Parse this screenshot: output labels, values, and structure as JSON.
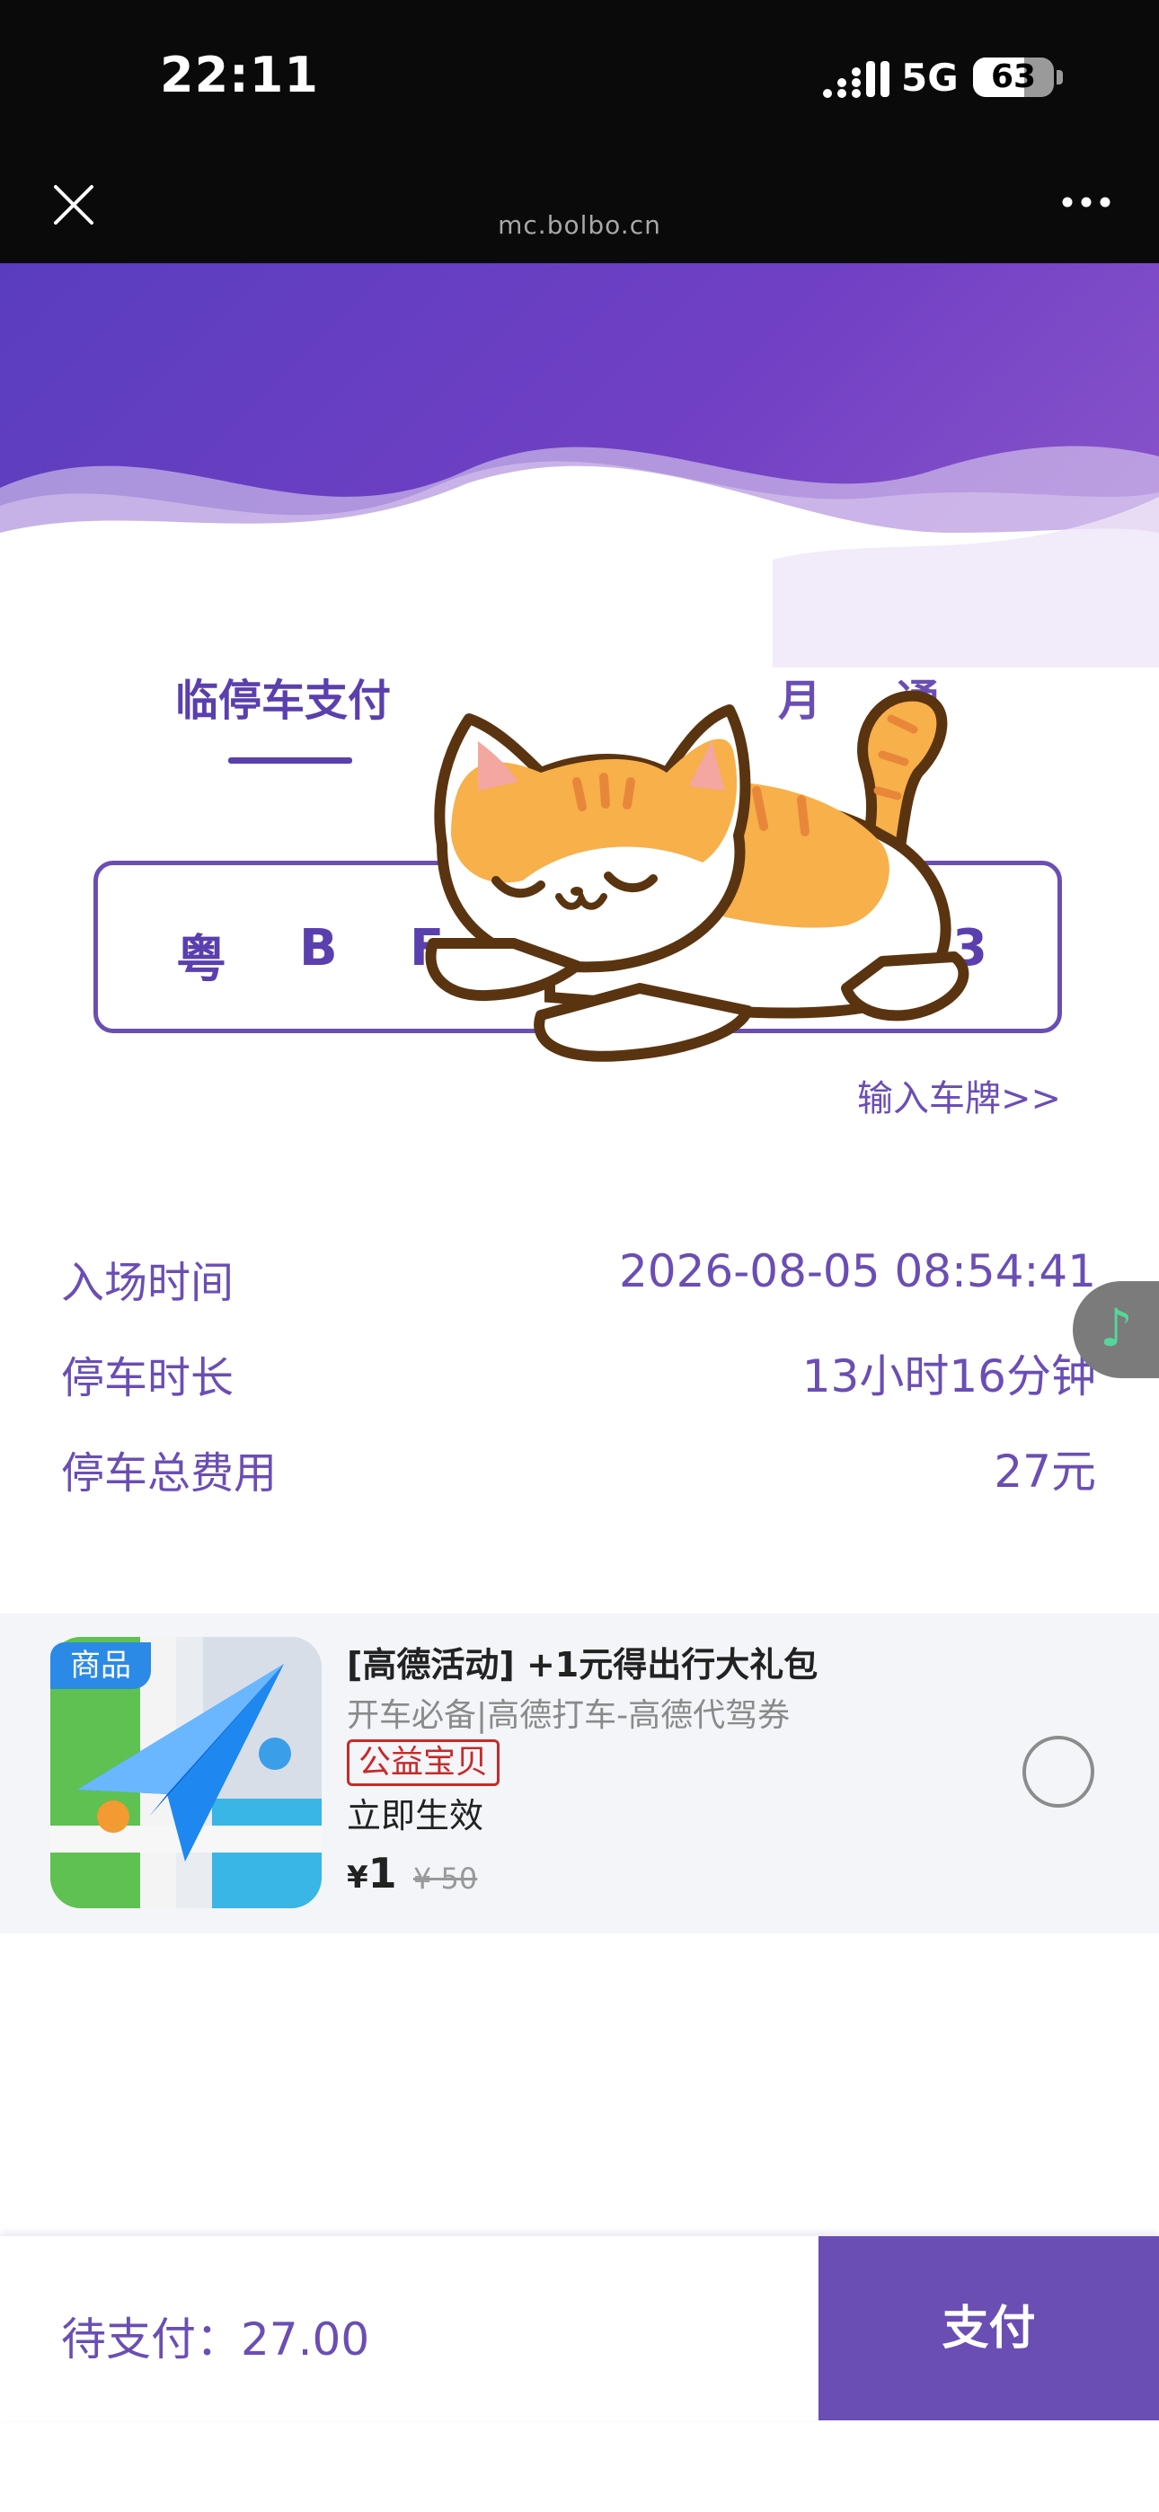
{
  "status_bar": {
    "time": "22:11",
    "network": "5G",
    "battery": "63",
    "battery_level": 0.63
  },
  "browser": {
    "url": "mc.bolbo.cn"
  },
  "tabs": [
    {
      "label": "临停车支付"
    },
    {
      "label": "月     通"
    }
  ],
  "plate": {
    "chars": [
      "粤",
      "B",
      "F",
      "3"
    ],
    "input_link": "输入车牌>>"
  },
  "details": [
    {
      "label": "入场时间",
      "value": "2026-08-05 08:54:41"
    },
    {
      "label": "停车时长",
      "value": "13小时16分钟"
    },
    {
      "label": "停车总费用",
      "value": "27元"
    }
  ],
  "product": {
    "badge": "商品",
    "title": "[高德活动] +1元得出行大礼包",
    "subtitle": "开车必备|高德打车-高德代驾券",
    "tag": "公益宝贝",
    "effect": "立即生效",
    "currency": "¥",
    "price": "1",
    "original_price": "¥ 50"
  },
  "footer": {
    "pending": "待支付：27.00",
    "pay_label": "支付"
  },
  "colors": {
    "accent": "#6a4eb4",
    "hero_start": "#5a3dbf",
    "hero_end": "#8e58cc"
  }
}
